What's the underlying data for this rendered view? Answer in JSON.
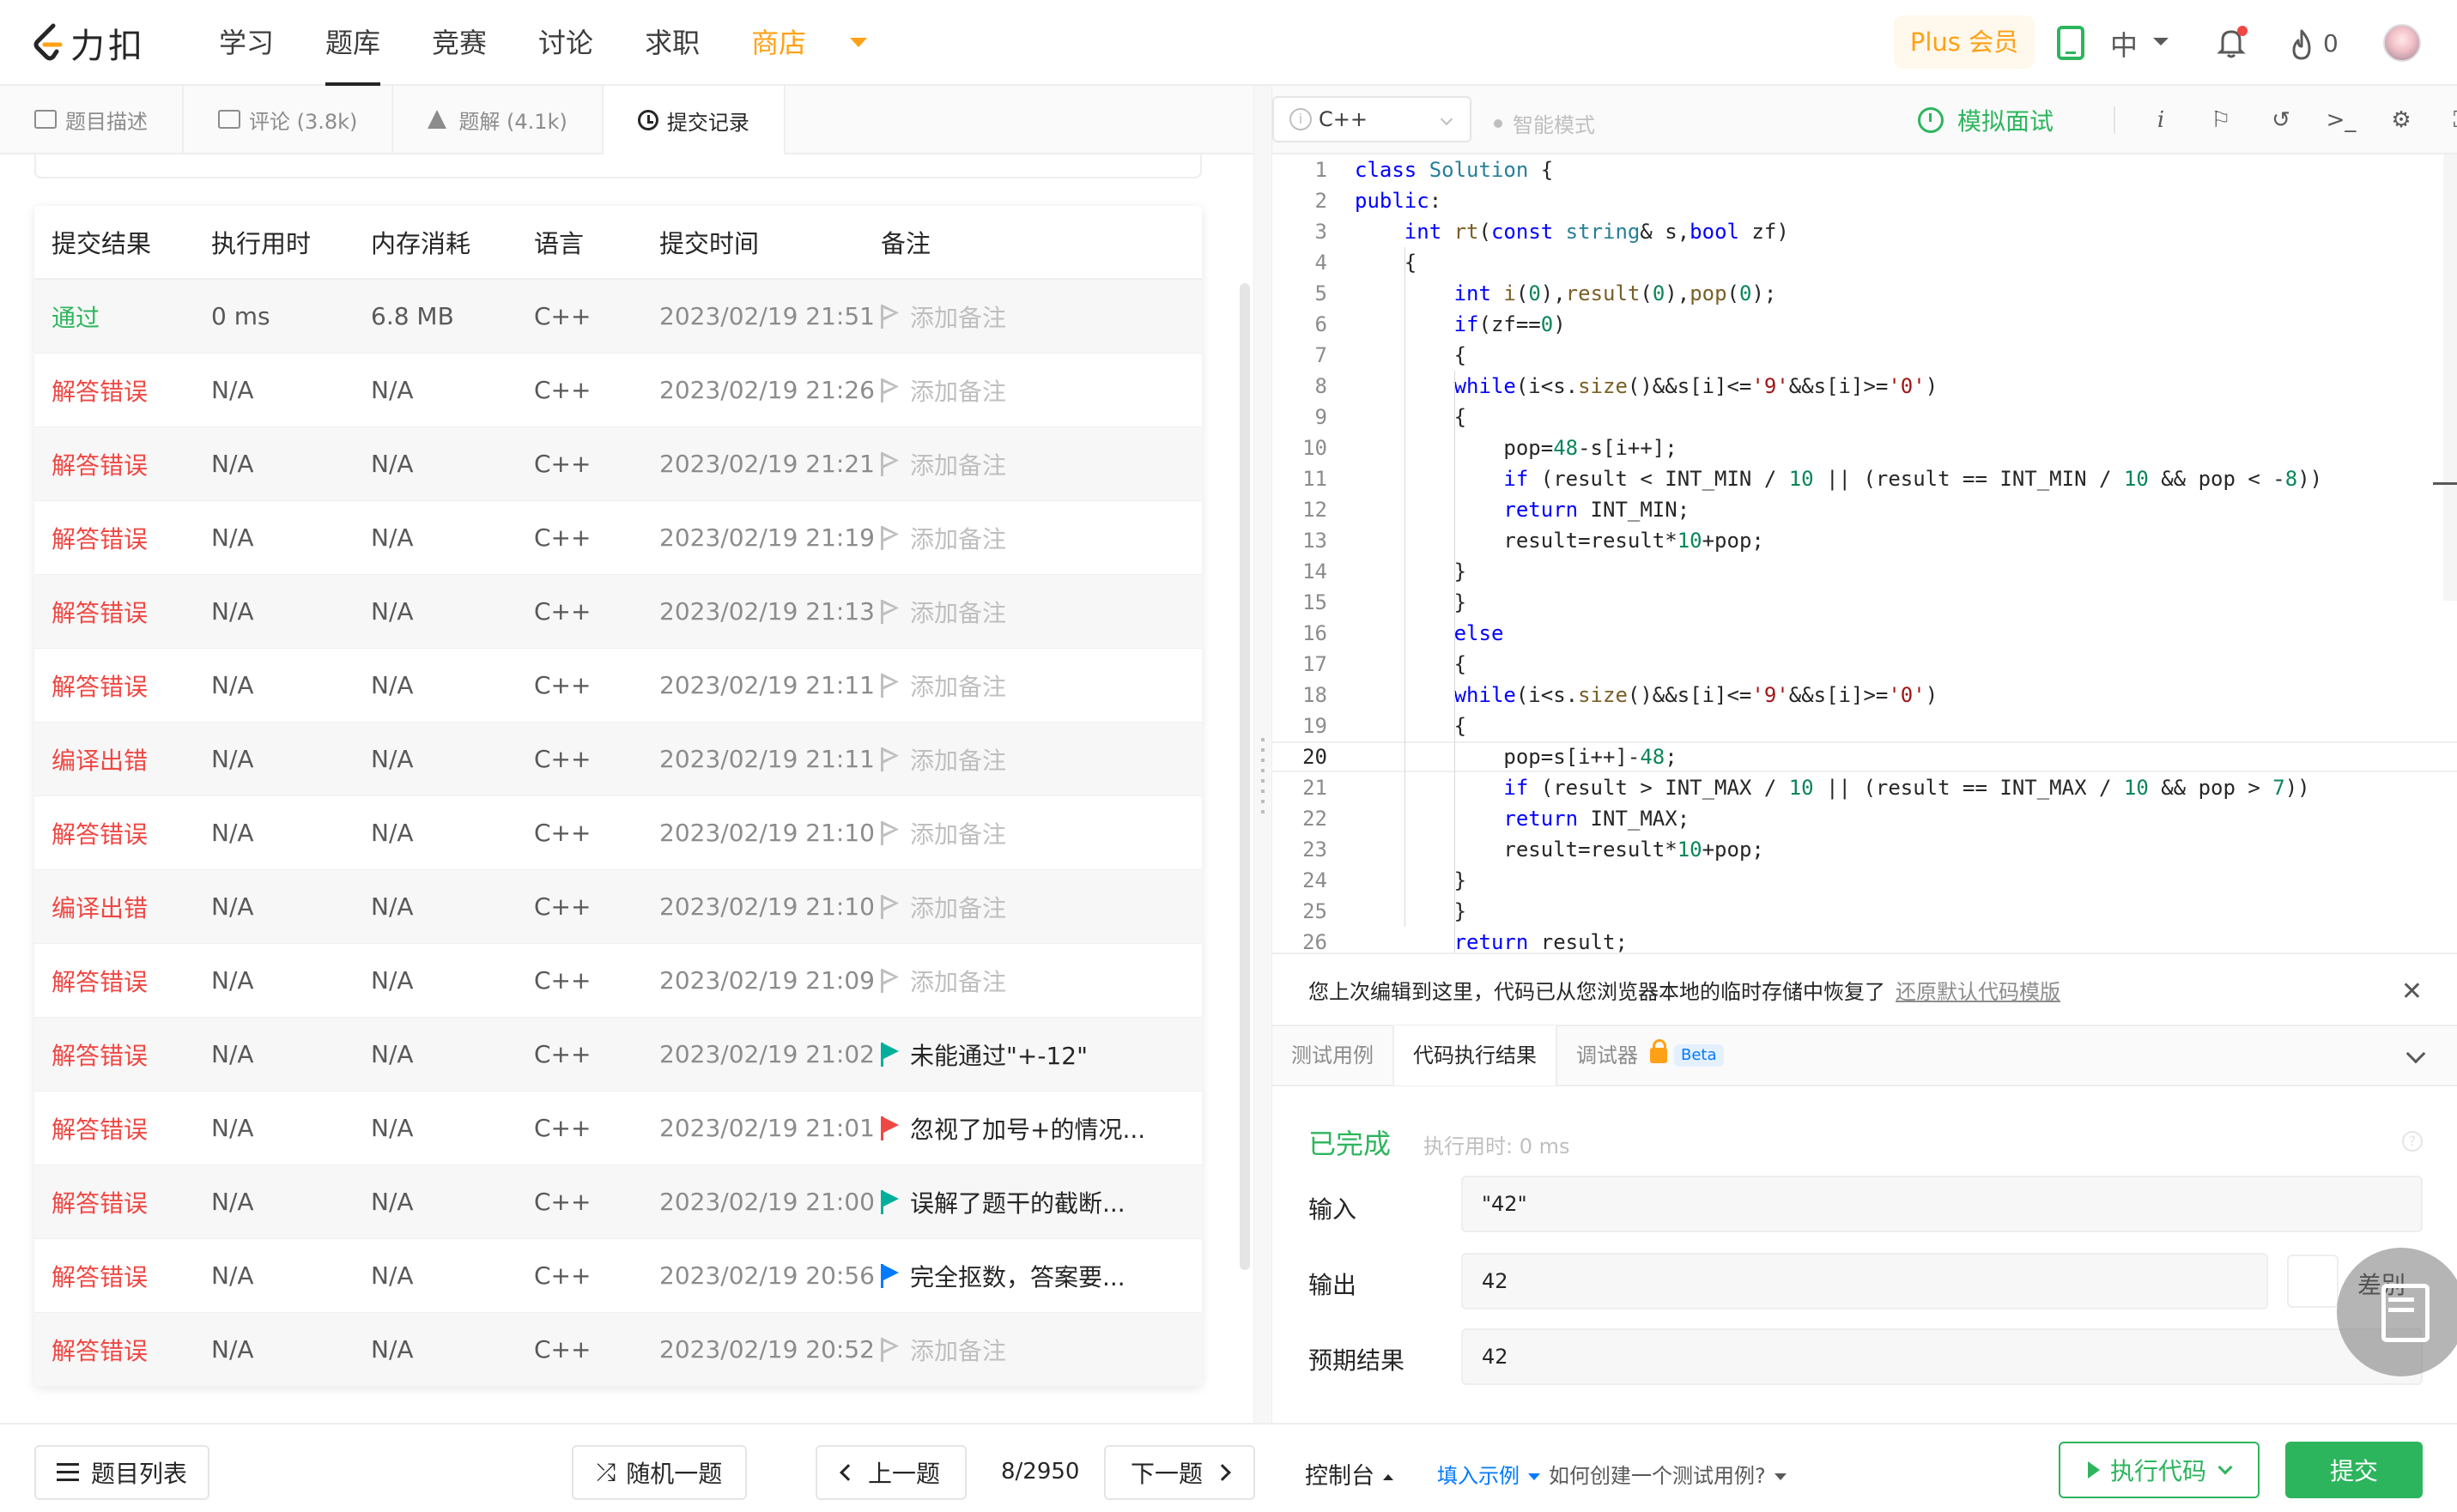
{
  "app": {
    "logo_text": "力扣"
  },
  "nav": {
    "items": [
      "学习",
      "题库",
      "竞赛",
      "讨论",
      "求职"
    ],
    "shop": "商店",
    "plus": "Plus 会员",
    "lang": "中",
    "points": "0",
    "active_index": 1
  },
  "left_tabs": [
    {
      "label": "题目描述",
      "icon": "document-icon"
    },
    {
      "label": "评论 (3.8k)",
      "icon": "comment-icon"
    },
    {
      "label": "题解 (4.1k)",
      "icon": "flask-icon"
    },
    {
      "label": "提交记录",
      "icon": "clock-icon"
    }
  ],
  "table": {
    "headers": [
      "提交结果",
      "执行用时",
      "内存消耗",
      "语言",
      "提交时间",
      "备注"
    ],
    "rows": [
      {
        "status": "通过",
        "status_type": "pass",
        "time": "0 ms",
        "memory": "6.8 MB",
        "lang": "C++",
        "submitted": "2023/02/19 21:51",
        "note": "添加备注",
        "flag": "outline",
        "flag_color": "#bfbfbf"
      },
      {
        "status": "解答错误",
        "status_type": "fail",
        "time": "N/A",
        "memory": "N/A",
        "lang": "C++",
        "submitted": "2023/02/19 21:26",
        "note": "添加备注",
        "flag": "outline",
        "flag_color": "#bfbfbf"
      },
      {
        "status": "解答错误",
        "status_type": "fail",
        "time": "N/A",
        "memory": "N/A",
        "lang": "C++",
        "submitted": "2023/02/19 21:21",
        "note": "添加备注",
        "flag": "outline",
        "flag_color": "#bfbfbf"
      },
      {
        "status": "解答错误",
        "status_type": "fail",
        "time": "N/A",
        "memory": "N/A",
        "lang": "C++",
        "submitted": "2023/02/19 21:19",
        "note": "添加备注",
        "flag": "outline",
        "flag_color": "#bfbfbf"
      },
      {
        "status": "解答错误",
        "status_type": "fail",
        "time": "N/A",
        "memory": "N/A",
        "lang": "C++",
        "submitted": "2023/02/19 21:13",
        "note": "添加备注",
        "flag": "outline",
        "flag_color": "#bfbfbf"
      },
      {
        "status": "解答错误",
        "status_type": "fail",
        "time": "N/A",
        "memory": "N/A",
        "lang": "C++",
        "submitted": "2023/02/19 21:11",
        "note": "添加备注",
        "flag": "outline",
        "flag_color": "#bfbfbf"
      },
      {
        "status": "编译出错",
        "status_type": "fail",
        "time": "N/A",
        "memory": "N/A",
        "lang": "C++",
        "submitted": "2023/02/19 21:11",
        "note": "添加备注",
        "flag": "outline",
        "flag_color": "#bfbfbf"
      },
      {
        "status": "解答错误",
        "status_type": "fail",
        "time": "N/A",
        "memory": "N/A",
        "lang": "C++",
        "submitted": "2023/02/19 21:10",
        "note": "添加备注",
        "flag": "outline",
        "flag_color": "#bfbfbf"
      },
      {
        "status": "编译出错",
        "status_type": "fail",
        "time": "N/A",
        "memory": "N/A",
        "lang": "C++",
        "submitted": "2023/02/19 21:10",
        "note": "添加备注",
        "flag": "outline",
        "flag_color": "#bfbfbf"
      },
      {
        "status": "解答错误",
        "status_type": "fail",
        "time": "N/A",
        "memory": "N/A",
        "lang": "C++",
        "submitted": "2023/02/19 21:09",
        "note": "添加备注",
        "flag": "outline",
        "flag_color": "#bfbfbf"
      },
      {
        "status": "解答错误",
        "status_type": "fail",
        "time": "N/A",
        "memory": "N/A",
        "lang": "C++",
        "submitted": "2023/02/19 21:02",
        "note": "未能通过\"+-12\"",
        "flag": "filled",
        "flag_color": "#00af9b"
      },
      {
        "status": "解答错误",
        "status_type": "fail",
        "time": "N/A",
        "memory": "N/A",
        "lang": "C++",
        "submitted": "2023/02/19 21:01",
        "note": "忽视了加号+的情况...",
        "flag": "filled",
        "flag_color": "#ef4743"
      },
      {
        "status": "解答错误",
        "status_type": "fail",
        "time": "N/A",
        "memory": "N/A",
        "lang": "C++",
        "submitted": "2023/02/19 21:00",
        "note": "误解了题干的截断...",
        "flag": "filled",
        "flag_color": "#00af9b"
      },
      {
        "status": "解答错误",
        "status_type": "fail",
        "time": "N/A",
        "memory": "N/A",
        "lang": "C++",
        "submitted": "2023/02/19 20:56",
        "note": "完全抠数，答案要...",
        "flag": "filled",
        "flag_color": "#007aff"
      },
      {
        "status": "解答错误",
        "status_type": "fail",
        "time": "N/A",
        "memory": "N/A",
        "lang": "C++",
        "submitted": "2023/02/19 20:52",
        "note": "添加备注",
        "flag": "outline",
        "flag_color": "#bfbfbf"
      }
    ]
  },
  "editor": {
    "language": "C++",
    "smart_mode": "智能模式",
    "mock_interview": "模拟面试",
    "toolbar_icons": [
      "info-icon",
      "flag-icon",
      "reset-icon",
      "terminal-icon",
      "settings-icon",
      "fullscreen-icon"
    ],
    "current_line": 20,
    "lines": [
      "class Solution {",
      "public:",
      "    int rt(const string& s,bool zf)",
      "    {",
      "        int i(0),result(0),pop(0);",
      "        if(zf==0)",
      "        {",
      "        while(i<s.size()&&s[i]<='9'&&s[i]>='0')",
      "        {",
      "            pop=48-s[i++];",
      "            if (result < INT_MIN / 10 || (result == INT_MIN / 10 && pop < -8))",
      "            return INT_MIN;",
      "            result=result*10+pop;",
      "        }",
      "        }",
      "        else",
      "        {",
      "        while(i<s.size()&&s[i]<='9'&&s[i]>='0')",
      "        {",
      "            pop=s[i++]-48;",
      "            if (result > INT_MAX / 10 || (result == INT_MAX / 10 && pop > 7))",
      "            return INT_MAX;",
      "            result=result*10+pop;",
      "        }",
      "        }",
      "        return result;"
    ]
  },
  "restore_notice": {
    "text": "您上次编辑到这里，代码已从您浏览器本地的临时存储中恢复了",
    "link": "还原默认代码模版"
  },
  "result_tabs": [
    "测试用例",
    "代码执行结果",
    "调试器"
  ],
  "beta": "Beta",
  "result": {
    "status": "已完成",
    "exec_time": "执行用时: 0 ms",
    "input_label": "输入",
    "input_value": "\"42\"",
    "output_label": "输出",
    "output_value": "42",
    "diff_label": "差别",
    "expected_label": "预期结果",
    "expected_value": "42"
  },
  "footer": {
    "problem_list": "题目列表",
    "random": "随机一题",
    "prev": "上一题",
    "page": "8/2950",
    "next": "下一题",
    "console": "控制台",
    "fill_example": "填入示例",
    "how_to": "如何创建一个测试用例?",
    "run": "执行代码",
    "submit": "提交"
  }
}
